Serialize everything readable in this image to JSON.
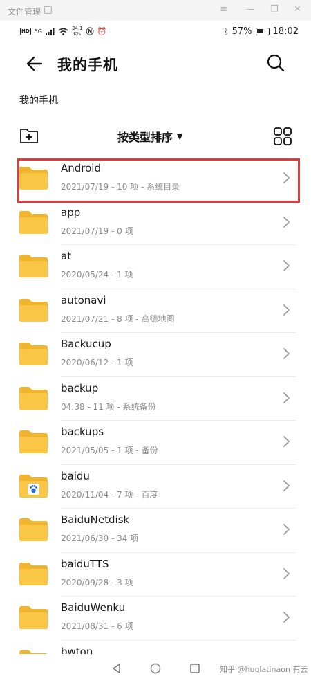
{
  "window": {
    "title": "文件管理"
  },
  "status_bar": {
    "network_type": "HD",
    "signal_label": "5G",
    "net_speed": "34.1",
    "net_speed_unit": "K/s",
    "battery": "57%",
    "time": "18:02"
  },
  "header": {
    "title": "我的手机"
  },
  "breadcrumb": "我的手机",
  "toolbar": {
    "sort_label": "按类型排序"
  },
  "colors": {
    "folder": "#f9c646",
    "highlight_border": "#e03b3b",
    "meta_text": "#8a8a8a"
  },
  "files": [
    {
      "name": "Android",
      "meta": "2021/07/19 - 10 项 - 系统目录",
      "icon": "folder-icon",
      "selected": true
    },
    {
      "name": "app",
      "meta": "2021/07/19 - 0 项",
      "icon": "folder-icon"
    },
    {
      "name": "at",
      "meta": "2020/05/24 - 1 项",
      "icon": "folder-icon"
    },
    {
      "name": "autonavi",
      "meta": "2021/07/21 - 8 项 - 高德地图",
      "icon": "folder-icon"
    },
    {
      "name": "Backucup",
      "meta": "2020/06/12 - 1 项",
      "icon": "folder-icon"
    },
    {
      "name": "backup",
      "meta": "04:38 - 11 项 - 系统备份",
      "icon": "folder-icon"
    },
    {
      "name": "backups",
      "meta": "2021/05/05 - 1 项 - 备份",
      "icon": "folder-icon"
    },
    {
      "name": "baidu",
      "meta": "2020/11/04 - 7 项 - 百度",
      "icon": "baidu-folder-icon"
    },
    {
      "name": "BaiduNetdisk",
      "meta": "2021/06/30 - 34 项",
      "icon": "folder-icon"
    },
    {
      "name": "baiduTTS",
      "meta": "2020/09/28 - 3 项",
      "icon": "folder-icon"
    },
    {
      "name": "BaiduWenku",
      "meta": "2021/08/31 - 6 项",
      "icon": "folder-icon"
    },
    {
      "name": "bwton",
      "meta": "",
      "icon": "folder-icon"
    }
  ],
  "watermark": "知乎 @huglatinaon 有云"
}
